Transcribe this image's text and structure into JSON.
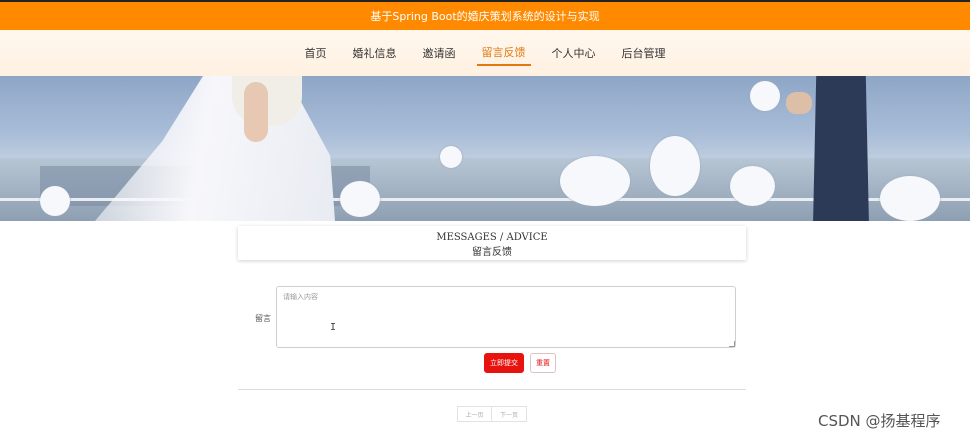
{
  "header": {
    "title": "基于Spring Boot的婚庆策划系统的设计与实现"
  },
  "nav": {
    "items": [
      {
        "label": "首页"
      },
      {
        "label": "婚礼信息"
      },
      {
        "label": "邀请函"
      },
      {
        "label": "留言反馈",
        "active": true
      },
      {
        "label": "个人中心"
      },
      {
        "label": "后台管理"
      }
    ]
  },
  "section": {
    "title_en": "MESSAGES / ADVICE",
    "title_cn": "留言反馈"
  },
  "form": {
    "label": "留言",
    "placeholder": "请输入内容",
    "value": "",
    "submit_label": "立即提交",
    "reset_label": "重置"
  },
  "pager": {
    "prev_label": "上一页",
    "next_label": "下一页"
  },
  "watermark": "CSDN @扬基程序",
  "colors": {
    "accent": "#ff8a00",
    "submit": "#e8120f",
    "nav_active": "#e07a10"
  }
}
